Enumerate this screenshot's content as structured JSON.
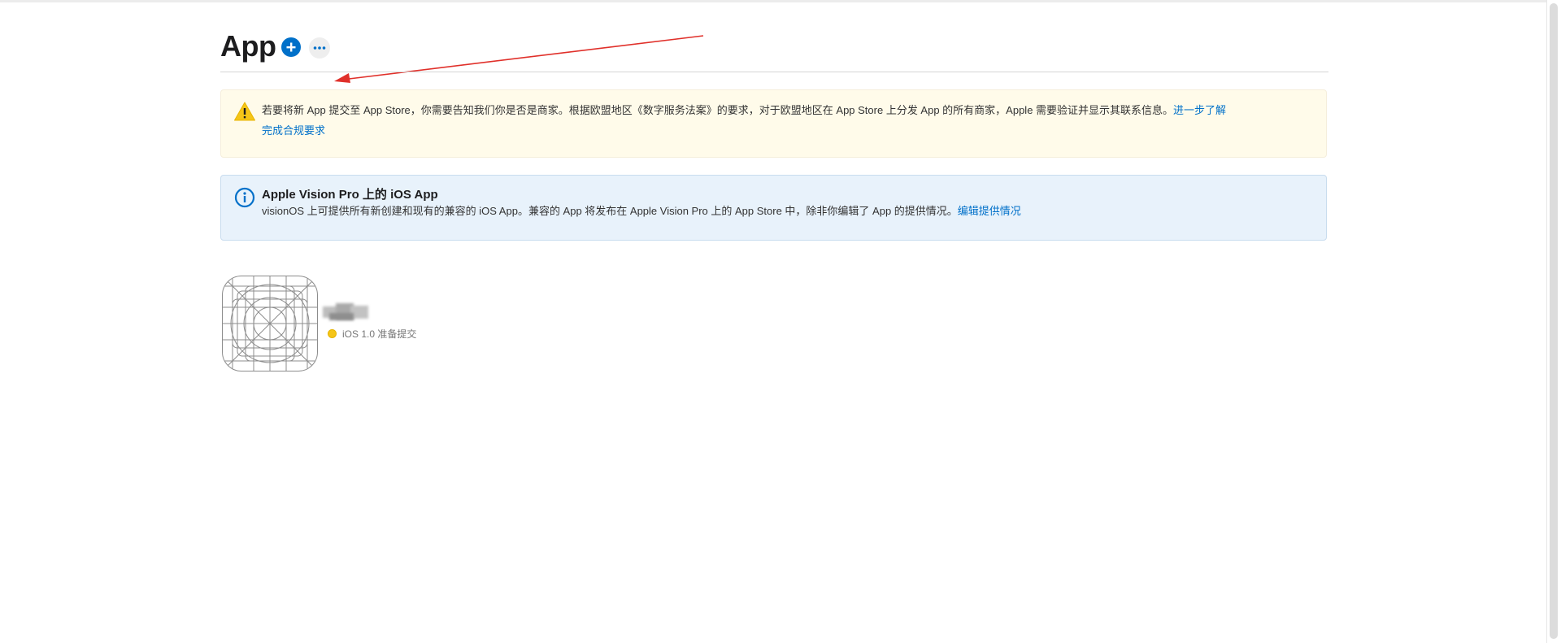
{
  "page": {
    "title": "App"
  },
  "icons": {
    "add": "plus-circle-icon",
    "more": "ellipsis-icon",
    "warning": "warning-triangle-icon",
    "info": "info-circle-icon"
  },
  "colors": {
    "accent": "#0070c9",
    "warning_bg": "#fffbea",
    "info_bg": "#e8f2fb",
    "status_yellow": "#f5c518",
    "annotation_arrow": "#e0302a"
  },
  "warning_banner": {
    "text": "若要将新 App 提交至 App Store，你需要告知我们你是否是商家。根据欧盟地区《数字服务法案》的要求，对于欧盟地区在 App Store 上分发 App 的所有商家，Apple 需要验证并显示其联系信息。",
    "learn_more_link": "进一步了解",
    "action_link": "完成合规要求"
  },
  "info_banner": {
    "title": "Apple Vision Pro 上的 iOS App",
    "text": "visionOS 上可提供所有新创建和现有的兼容的 iOS App。兼容的 App 将发布在 Apple Vision Pro 上的 App Store 中，除非你编辑了 App 的提供情况。",
    "edit_link": "编辑提供情况"
  },
  "apps": [
    {
      "status": "iOS 1.0 准备提交",
      "status_color": "#f5c518"
    }
  ]
}
